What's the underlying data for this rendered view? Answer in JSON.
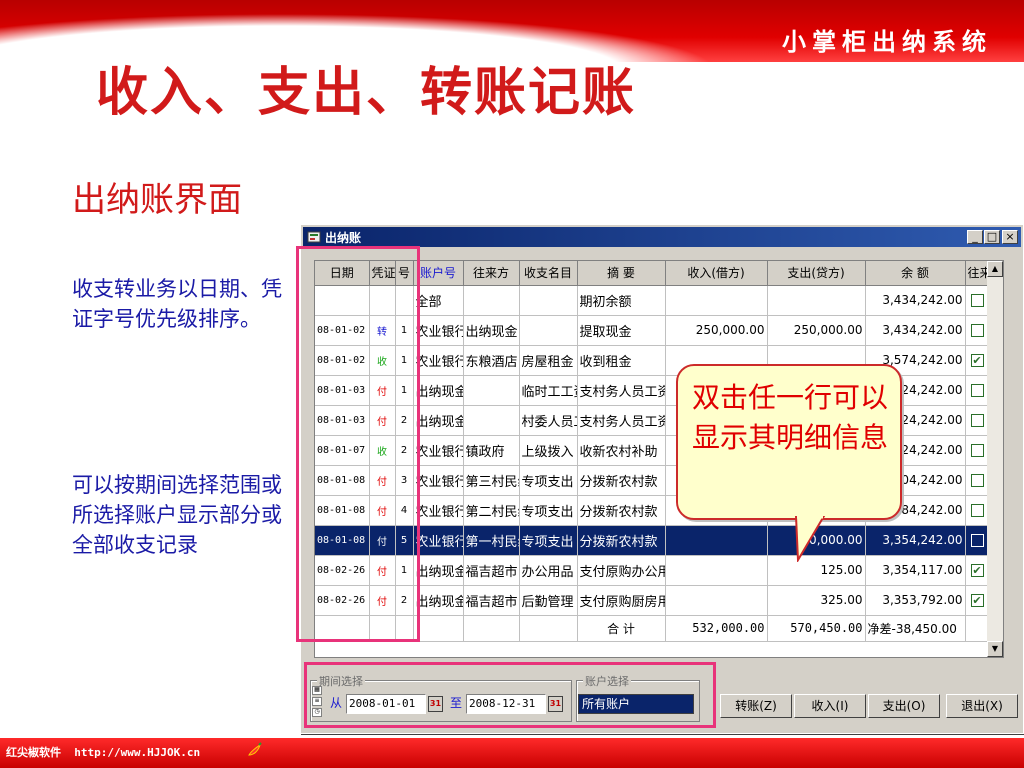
{
  "slide": {
    "brand": "小掌柜出纳系统",
    "title": "收入、支出、转账记账",
    "section_title": "出纳账界面",
    "note_sort": "收支转业务以日期、凭证字号优先级排序。",
    "note_filter": "可以按期间选择范围或所选择账户显示部分或全部收支记录",
    "callout": "双击任一行可以显示其明细信息",
    "footer": "红尖椒软件  http://www.HJJOK.cn"
  },
  "window": {
    "title": "出纳账",
    "min_glyph": "_",
    "max_glyph": "□",
    "close_glyph": "×"
  },
  "grid": {
    "headers": [
      "日期",
      "凭证",
      "号",
      "账户号",
      "往来方",
      "收支名目",
      "摘  要",
      "收入(借方)",
      "支出(贷方)",
      "余 额",
      "往来"
    ],
    "rows": [
      {
        "date": "",
        "type": "",
        "num": "",
        "account": "全部",
        "party": "",
        "item": "",
        "summary": "期初余额",
        "income": "",
        "expense": "",
        "balance": "3,434,242.00",
        "check": ""
      },
      {
        "date": "08-01-02",
        "type": "转",
        "num": "1",
        "account": "农业银行",
        "party": "出纳现金",
        "item": "",
        "summary": "提取现金",
        "income": "250,000.00",
        "expense": "250,000.00",
        "balance": "3,434,242.00",
        "check": ""
      },
      {
        "date": "08-01-02",
        "type": "收",
        "num": "1",
        "account": "农业银行",
        "party": "东粮酒店",
        "item": "房屋租金",
        "summary": "收到租金",
        "income": "",
        "expense": "",
        "balance": "3,574,242.00",
        "check": "✔"
      },
      {
        "date": "08-01-03",
        "type": "付",
        "num": "1",
        "account": "出纳现金",
        "party": "",
        "item": "临时工工资",
        "summary": "支村务人员工资",
        "income": "",
        "expense": "",
        "balance": "3,524,242.00",
        "check": ""
      },
      {
        "date": "08-01-03",
        "type": "付",
        "num": "2",
        "account": "出纳现金",
        "party": "",
        "item": "村委人员工资",
        "summary": "支村务人员工资",
        "income": "",
        "expense": "",
        "balance": "3,424,242.00",
        "check": ""
      },
      {
        "date": "08-01-07",
        "type": "收",
        "num": "2",
        "account": "农业银行",
        "party": "镇政府",
        "item": "上级拨入",
        "summary": "收新农村补助",
        "income": "",
        "expense": "",
        "balance": "3,524,242.00",
        "check": ""
      },
      {
        "date": "08-01-08",
        "type": "付",
        "num": "3",
        "account": "农业银行",
        "party": "第三村民组",
        "item": "专项支出",
        "summary": "分拨新农村款",
        "income": "",
        "expense": "",
        "balance": "3,404,242.00",
        "check": ""
      },
      {
        "date": "08-01-08",
        "type": "付",
        "num": "4",
        "account": "农业银行",
        "party": "第二村民组",
        "item": "专项支出",
        "summary": "分拨新农村款",
        "income": "",
        "expense": "20,000.00",
        "balance": "3,384,242.00",
        "check": ""
      },
      {
        "date": "08-01-08",
        "type": "付",
        "num": "5",
        "account": "农业银行",
        "party": "第一村民组",
        "item": "专项支出",
        "summary": "分拨新农村款",
        "income": "",
        "expense": "30,000.00",
        "balance": "3,354,242.00",
        "check": ""
      },
      {
        "date": "08-02-26",
        "type": "付",
        "num": "1",
        "account": "出纳现金",
        "party": "福吉超市",
        "item": "办公用品",
        "summary": "支付原购办公用品",
        "income": "",
        "expense": "125.00",
        "balance": "3,354,117.00",
        "check": "✔"
      },
      {
        "date": "08-02-26",
        "type": "付",
        "num": "2",
        "account": "出纳现金",
        "party": "福吉超市",
        "item": "后勤管理",
        "summary": "支付原购厨房用品",
        "income": "",
        "expense": "325.00",
        "balance": "3,353,792.00",
        "check": "✔"
      }
    ],
    "total_label": "合 计",
    "total_income": "532,000.00",
    "total_expense": "570,450.00",
    "net_label": "净差-38,450.00"
  },
  "filter": {
    "period_legend": "期间选择",
    "account_legend": "账户选择",
    "from_label": "从",
    "to_label": "至",
    "from_date": "2008-01-01",
    "to_date": "2008-12-31",
    "account_value": "所有账户"
  },
  "buttons": {
    "transfer": "转账(Z)",
    "income": "收入(I)",
    "expense": "支出(O)",
    "exit": "退出(X)"
  }
}
